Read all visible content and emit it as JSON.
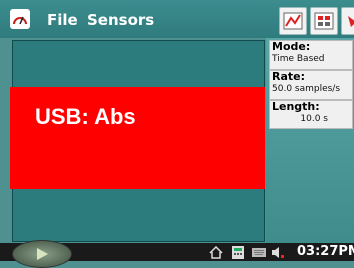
{
  "menu": {
    "file": "File",
    "sensors": "Sensors"
  },
  "icons": {
    "app": "gauge-icon",
    "graph_view": "graph-icon",
    "meter_view": "meter-icon",
    "extra_tool": "tool-icon",
    "start": "play-icon",
    "home": "home-icon",
    "calc": "calculator-icon",
    "keyboard": "keyboard-icon",
    "volume": "speaker-icon"
  },
  "info": {
    "mode_label": "Mode:",
    "mode_value": "Time Based",
    "rate_label": "Rate:",
    "rate_value": "50.0 samples/s",
    "length_label": "Length:",
    "length_value": "10.0 s"
  },
  "banner": {
    "text": "USB: Abs",
    "color": "#ff0000"
  },
  "taskbar": {
    "clock": "03:27PM"
  }
}
